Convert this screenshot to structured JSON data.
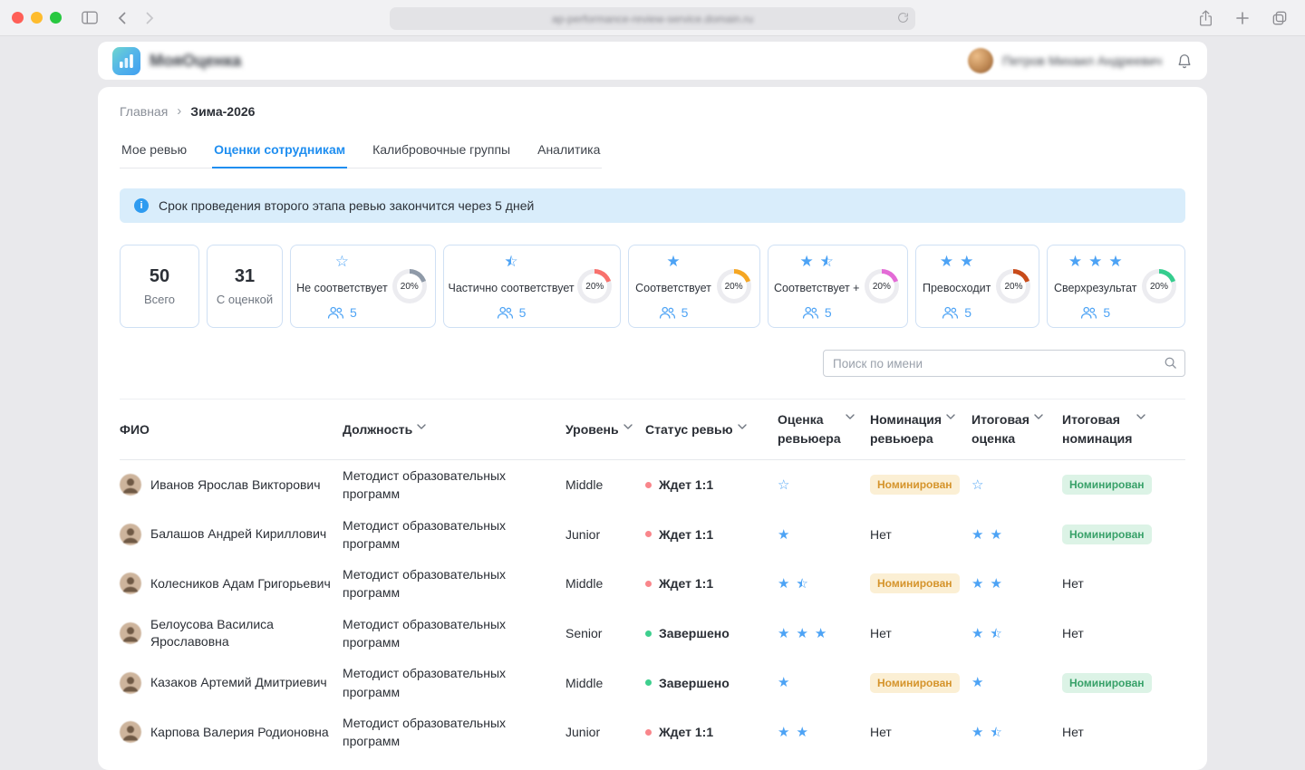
{
  "browser": {
    "url_text": "ap-performance-review-service.domain.ru"
  },
  "app_header": {
    "brand": "МояОценка",
    "user_name": "Петров Михаил Андреевич"
  },
  "breadcrumb": {
    "home": "Главная",
    "current": "Зима-2026"
  },
  "tabs": [
    {
      "key": "my-review",
      "label": "Мое ревью",
      "active": false
    },
    {
      "key": "employee-ratings",
      "label": "Оценки сотрудникам",
      "active": true
    },
    {
      "key": "calibration-groups",
      "label": "Калибровочные группы",
      "active": false
    },
    {
      "key": "analytics",
      "label": "Аналитика",
      "active": false
    }
  ],
  "banner": {
    "text": "Срок проведения второго этапа ревью закончится через 5 дней"
  },
  "stats": {
    "totals": [
      {
        "value": "50",
        "label": "Всего"
      },
      {
        "value": "31",
        "label": "С оценкой"
      }
    ],
    "rating_cards": [
      {
        "key": "not-meeting",
        "label": "Не соответствует",
        "stars": [
          "outline"
        ],
        "percent": 20,
        "percent_label": "20%",
        "count": "5",
        "color": "#8f9aa8"
      },
      {
        "key": "partially-meeting",
        "label": "Частично соответствует",
        "stars": [
          "half"
        ],
        "percent": 20,
        "percent_label": "20%",
        "count": "5",
        "color": "#f8716d"
      },
      {
        "key": "meeting",
        "label": "Соответствует",
        "stars": [
          "full"
        ],
        "percent": 20,
        "percent_label": "20%",
        "count": "5",
        "color": "#f5a623"
      },
      {
        "key": "meeting-plus",
        "label": "Соответствует +",
        "stars": [
          "full",
          "half"
        ],
        "percent": 20,
        "percent_label": "20%",
        "count": "5",
        "color": "#e36bd6"
      },
      {
        "key": "exceeding",
        "label": "Превосходит",
        "stars": [
          "full",
          "full"
        ],
        "percent": 20,
        "percent_label": "20%",
        "count": "5",
        "color": "#c84b1a"
      },
      {
        "key": "outstanding",
        "label": "Сверхрезультат",
        "stars": [
          "full",
          "full",
          "full"
        ],
        "percent": 20,
        "percent_label": "20%",
        "count": "5",
        "color": "#35cd8e"
      }
    ]
  },
  "search": {
    "placeholder": "Поиск по имени"
  },
  "table": {
    "columns": [
      {
        "key": "fio",
        "label": "ФИО",
        "sortable": false
      },
      {
        "key": "position",
        "label": "Должность",
        "sortable": true
      },
      {
        "key": "level",
        "label": "Уровень",
        "sortable": true
      },
      {
        "key": "review-status",
        "label": "Статус ревью",
        "sortable": true
      },
      {
        "key": "reviewer-rating",
        "label": "Оценка\nревьюера",
        "sortable": true
      },
      {
        "key": "reviewer-nomination",
        "label": "Номинация\nревьюера",
        "sortable": true
      },
      {
        "key": "final-rating",
        "label": "Итоговая\nоценка",
        "sortable": true
      },
      {
        "key": "final-nomination",
        "label": "Итоговая\nноминация",
        "sortable": true
      }
    ],
    "rows": [
      {
        "name": "Иванов Ярослав Викторович",
        "position": "Методист образовательных программ",
        "level": "Middle",
        "status": {
          "label": "Ждет 1:1",
          "type": "pending"
        },
        "reviewer_rating": [
          "outline"
        ],
        "reviewer_nomination": {
          "label": "Номинирован",
          "type": "nominated"
        },
        "final_rating": [
          "outline"
        ],
        "final_nomination": {
          "label": "Номинирован",
          "type": "approved"
        }
      },
      {
        "name": "Балашов Андрей Кириллович",
        "position": "Методист образовательных программ",
        "level": "Junior",
        "status": {
          "label": "Ждет 1:1",
          "type": "pending"
        },
        "reviewer_rating": [
          "full"
        ],
        "reviewer_nomination": {
          "label": "Нет",
          "type": "none"
        },
        "final_rating": [
          "full",
          "full"
        ],
        "final_nomination": {
          "label": "Номинирован",
          "type": "approved"
        }
      },
      {
        "name": "Колесников Адам Григорьевич",
        "position": "Методист образовательных программ",
        "level": "Middle",
        "status": {
          "label": "Ждет 1:1",
          "type": "pending"
        },
        "reviewer_rating": [
          "full",
          "half"
        ],
        "reviewer_nomination": {
          "label": "Номинирован",
          "type": "nominated"
        },
        "final_rating": [
          "full",
          "full"
        ],
        "final_nomination": {
          "label": "Нет",
          "type": "none"
        }
      },
      {
        "name": "Белоусова Василиса Ярославовна",
        "position": "Методист образовательных программ",
        "level": "Senior",
        "status": {
          "label": "Завершено",
          "type": "done"
        },
        "reviewer_rating": [
          "full",
          "full",
          "full"
        ],
        "reviewer_nomination": {
          "label": "Нет",
          "type": "none"
        },
        "final_rating": [
          "full",
          "half"
        ],
        "final_nomination": {
          "label": "Нет",
          "type": "none"
        }
      },
      {
        "name": "Казаков Артемий Дмитриевич",
        "position": "Методист образовательных программ",
        "level": "Middle",
        "status": {
          "label": "Завершено",
          "type": "done"
        },
        "reviewer_rating": [
          "full"
        ],
        "reviewer_nomination": {
          "label": "Номинирован",
          "type": "nominated"
        },
        "final_rating": [
          "full"
        ],
        "final_nomination": {
          "label": "Номинирован",
          "type": "approved"
        }
      },
      {
        "name": "Карпова Валерия Родионовна",
        "position": "Методист образовательных программ",
        "level": "Junior",
        "status": {
          "label": "Ждет 1:1",
          "type": "pending"
        },
        "reviewer_rating": [
          "full",
          "full"
        ],
        "reviewer_nomination": {
          "label": "Нет",
          "type": "none"
        },
        "final_rating": [
          "full",
          "half"
        ],
        "final_nomination": {
          "label": "Нет",
          "type": "none"
        }
      }
    ]
  },
  "colors": {
    "accent": "#1f8ef0",
    "star": "#4da3f5",
    "banner_bg": "#d9edfb",
    "status_pending": "#f9868b",
    "status_done": "#3ecf8e",
    "badge_nominated_text": "#d5942b",
    "badge_nominated_bg": "#fbefd4",
    "badge_approved_text": "#38a169",
    "badge_approved_bg": "#dcf3e6",
    "donut_track": "#ececf0"
  }
}
